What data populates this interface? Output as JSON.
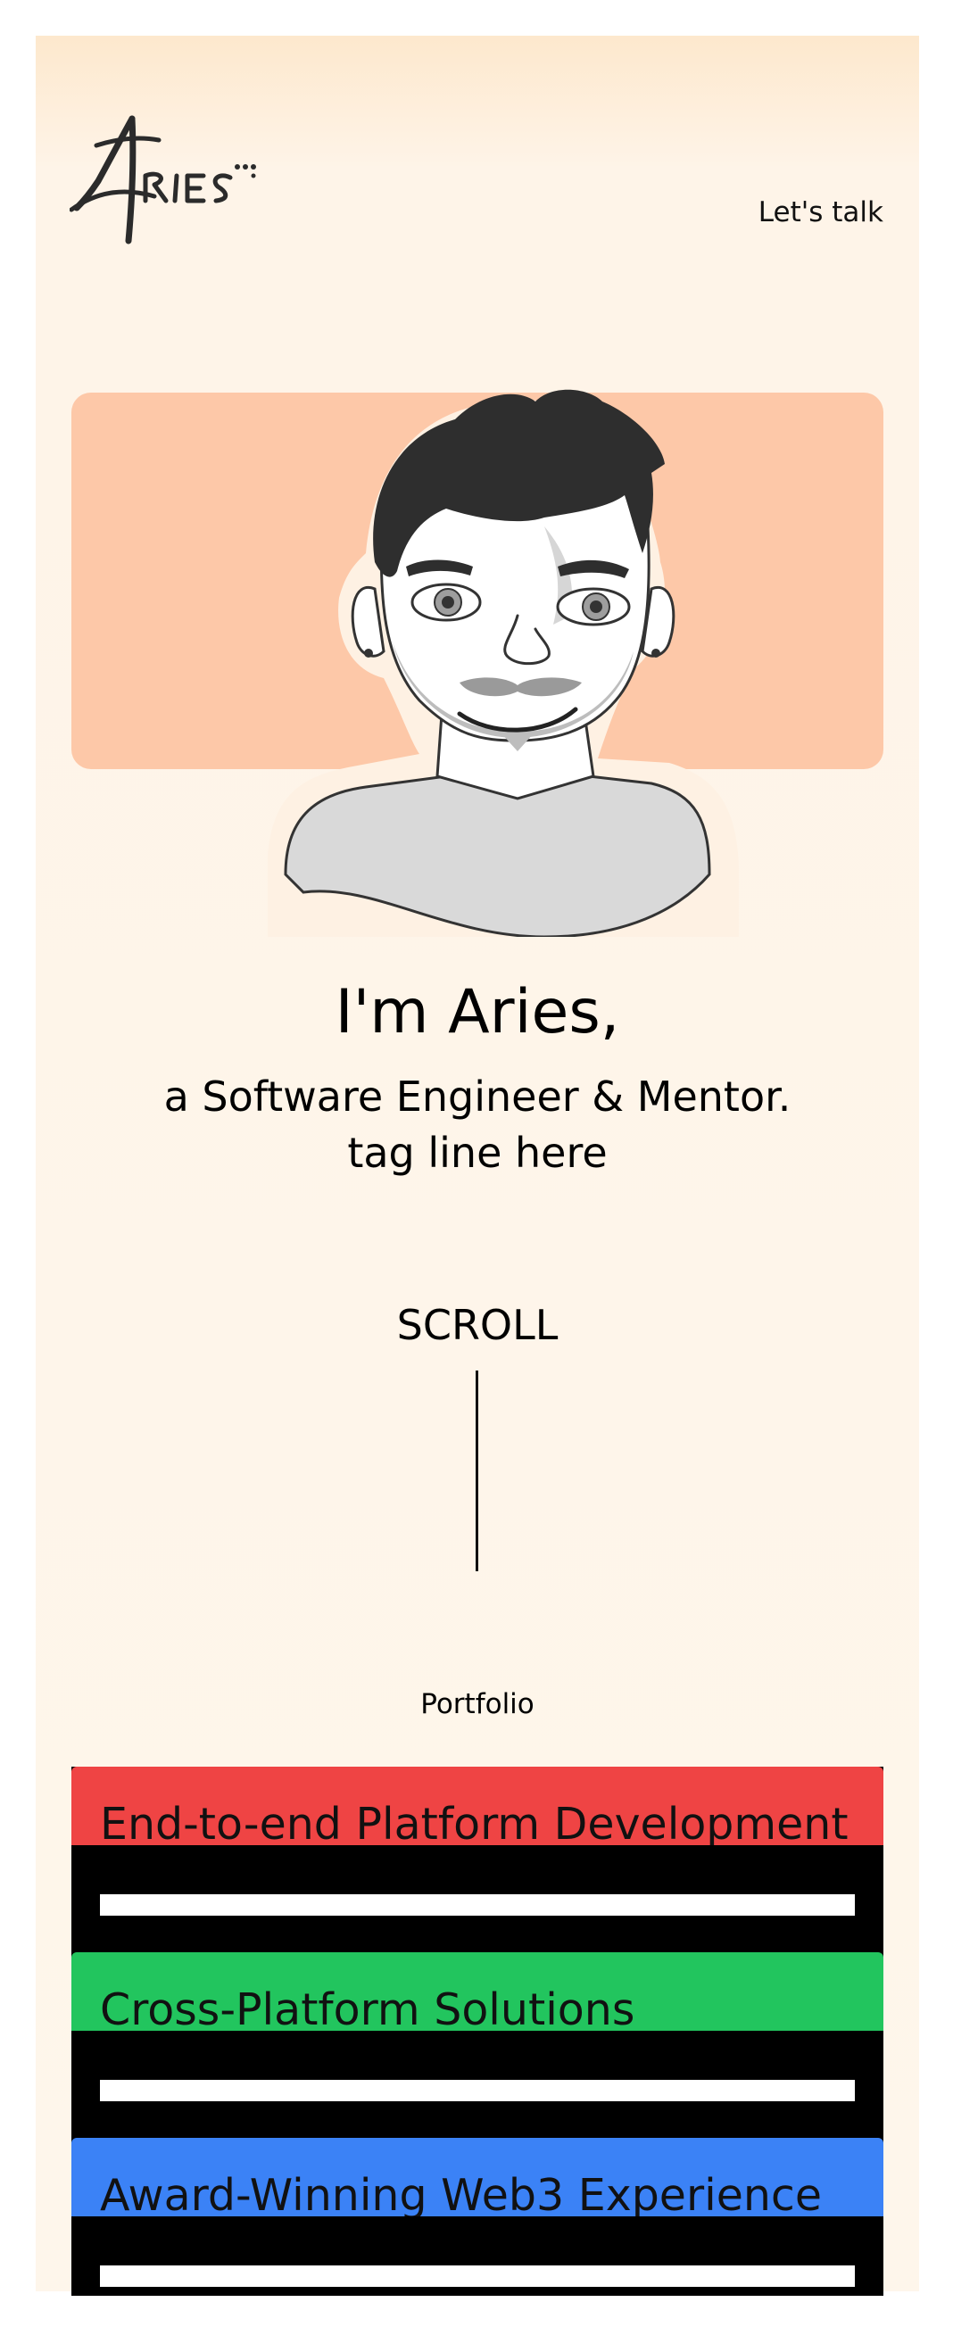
{
  "header": {
    "logo_text": "ARIES",
    "cta_label": "Let's talk"
  },
  "hero": {
    "name": "I'm Aries,",
    "role": "a Software Engineer & Mentor.",
    "tagline": "tag line here",
    "accent_color": "#fdc8a8"
  },
  "scroll": {
    "label": "SCROLL"
  },
  "portfolio": {
    "label": "Portfolio",
    "items": [
      {
        "title": "End-to-end Platform Development",
        "color": "#ef4444"
      },
      {
        "title": "Cross-Platform Solutions",
        "color": "#22c55e"
      },
      {
        "title": "Award-Winning Web3 Experience",
        "color": "#3b82f6"
      }
    ]
  }
}
